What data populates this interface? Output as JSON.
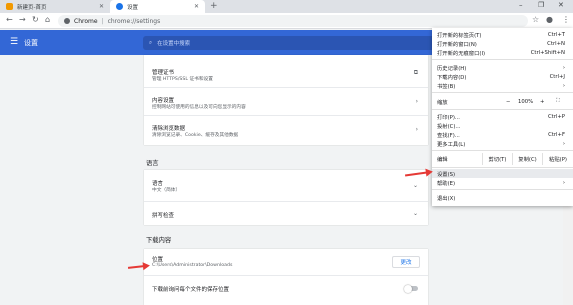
{
  "tabs": [
    {
      "label": "新建页-首页",
      "favicon_color": "#f29900"
    },
    {
      "label": "设置",
      "favicon_color": "#1a73e8"
    }
  ],
  "toolbar": {
    "site_label": "Chrome",
    "separator": "|",
    "url": "chrome://settings"
  },
  "header": {
    "title": "设置",
    "search_placeholder": "在设置中搜索"
  },
  "privacy_card": {
    "manage_certificates": {
      "title": "管理证书",
      "sub": "管理 HTTPS/SSL 证书和设置"
    },
    "content_settings": {
      "title": "内容设置",
      "sub": "控制网站可使用的信息以及可向您显示的内容"
    },
    "clear_browsing": {
      "title": "清除浏览数据",
      "sub": "清除浏览记录、Cookie、缓存及其他数据"
    }
  },
  "languages": {
    "section_title": "语言",
    "language_row": {
      "title": "语言",
      "sub": "中文（简体）"
    },
    "spellcheck": {
      "title": "拼写检查"
    }
  },
  "downloads": {
    "section_title": "下载内容",
    "location": {
      "title": "位置",
      "path": "C:\\Users\\Administrator\\Downloads",
      "button": "更改"
    },
    "ask_where": {
      "title": "下载前询问每个文件的保存位置"
    }
  },
  "menu": {
    "new_tab": {
      "label": "打开新的标签页(T)",
      "shortcut": "Ctrl+T"
    },
    "new_window": {
      "label": "打开新的窗口(N)",
      "shortcut": "Ctrl+N"
    },
    "incognito": {
      "label": "打开新的无痕窗口(I)",
      "shortcut": "Ctrl+Shift+N"
    },
    "history": {
      "label": "历史记录(H)"
    },
    "downloads": {
      "label": "下载内容(D)",
      "shortcut": "Ctrl+J"
    },
    "bookmarks": {
      "label": "书签(B)"
    },
    "zoom": {
      "label": "缩放",
      "minus": "−",
      "value": "100%",
      "plus": "+"
    },
    "print": {
      "label": "打印(P)...",
      "shortcut": "Ctrl+P"
    },
    "cast": {
      "label": "投射(C)..."
    },
    "find": {
      "label": "查找(F)...",
      "shortcut": "Ctrl+F"
    },
    "more_tools": {
      "label": "更多工具(L)"
    },
    "edit": {
      "label": "编辑",
      "cut": "剪切(T)",
      "copy": "复制(C)",
      "paste": "粘贴(P)"
    },
    "settings": {
      "label": "设置(S)"
    },
    "help": {
      "label": "帮助(E)"
    },
    "exit": {
      "label": "退出(X)"
    }
  },
  "colors": {
    "accent": "#3367d6",
    "arrow": "#e53935"
  }
}
